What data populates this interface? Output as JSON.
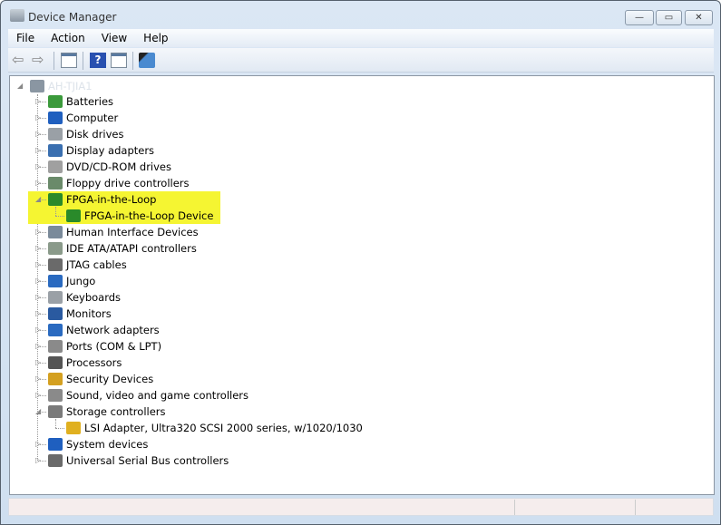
{
  "window": {
    "title": "Device Manager",
    "minimize": "—",
    "maximize": "▭",
    "close": "✕"
  },
  "menu": [
    "File",
    "Action",
    "View",
    "Help"
  ],
  "toolbar": [
    {
      "icon": "back-arrow-icon"
    },
    {
      "icon": "forward-arrow-icon"
    },
    {
      "icon": "show-hide-console-tree-icon"
    },
    {
      "icon": "help-icon"
    },
    {
      "icon": "show-hide-action-pane-icon"
    },
    {
      "icon": "scan-hardware-changes-icon"
    }
  ],
  "tree": {
    "root": "AH-TJIA1",
    "items": [
      {
        "label": "Batteries",
        "icon": "battery-icon",
        "color": "#3b9a3b"
      },
      {
        "label": "Computer",
        "icon": "computer-icon",
        "color": "#1f5fbf"
      },
      {
        "label": "Disk drives",
        "icon": "disk-drive-icon",
        "color": "#9aa0a6"
      },
      {
        "label": "Display adapters",
        "icon": "display-adapter-icon",
        "color": "#3a6fb0"
      },
      {
        "label": "DVD/CD-ROM drives",
        "icon": "dvd-drive-icon",
        "color": "#a0a0a0"
      },
      {
        "label": "Floppy drive controllers",
        "icon": "floppy-controller-icon",
        "color": "#6a8a6a"
      },
      {
        "label": "FPGA-in-the-Loop",
        "icon": "network-device-icon",
        "color": "#2a8a2a",
        "expanded": true,
        "highlight": true,
        "children": [
          {
            "label": "FPGA-in-the-Loop Device",
            "icon": "network-device-icon",
            "color": "#2a8a2a",
            "highlight": true
          }
        ]
      },
      {
        "label": "Human Interface Devices",
        "icon": "hid-icon",
        "color": "#7a8a9a"
      },
      {
        "label": "IDE ATA/ATAPI controllers",
        "icon": "ide-controller-icon",
        "color": "#8a9a8a"
      },
      {
        "label": "JTAG cables",
        "icon": "jtag-cable-icon",
        "color": "#6a6a6a"
      },
      {
        "label": "Jungo",
        "icon": "network-device-icon",
        "color": "#2a6ac0"
      },
      {
        "label": "Keyboards",
        "icon": "keyboard-icon",
        "color": "#9aa0a6"
      },
      {
        "label": "Monitors",
        "icon": "monitor-icon",
        "color": "#2a5aa0"
      },
      {
        "label": "Network adapters",
        "icon": "network-adapter-icon",
        "color": "#2a6ac0"
      },
      {
        "label": "Ports (COM & LPT)",
        "icon": "port-icon",
        "color": "#8a8a8a"
      },
      {
        "label": "Processors",
        "icon": "processor-icon",
        "color": "#555555"
      },
      {
        "label": "Security Devices",
        "icon": "key-icon",
        "color": "#d4a020"
      },
      {
        "label": "Sound, video and game controllers",
        "icon": "speaker-icon",
        "color": "#8a8a8a"
      },
      {
        "label": "Storage controllers",
        "icon": "storage-controller-icon",
        "color": "#7a7a7a",
        "expanded": true,
        "children": [
          {
            "label": "LSI Adapter, Ultra320 SCSI 2000 series, w/1020/1030",
            "icon": "storage-warning-icon",
            "color": "#e0b020"
          }
        ]
      },
      {
        "label": "System devices",
        "icon": "system-device-icon",
        "color": "#1f5fbf"
      },
      {
        "label": "Universal Serial Bus controllers",
        "icon": "usb-icon",
        "color": "#6a6a6a"
      }
    ]
  }
}
